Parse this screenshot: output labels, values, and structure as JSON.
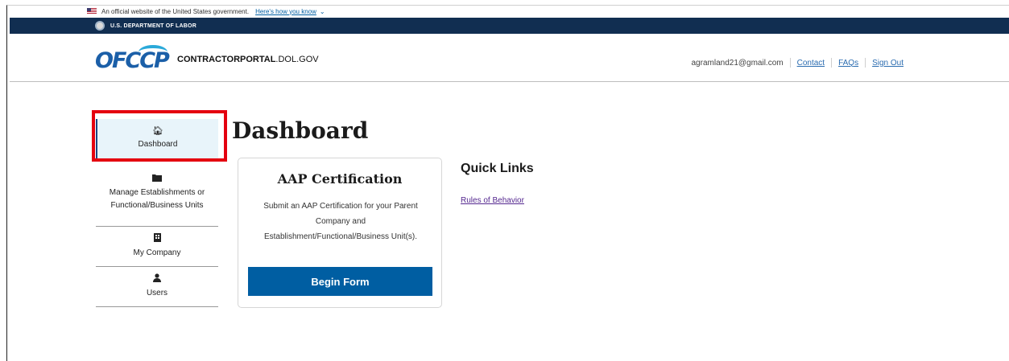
{
  "gov_banner": {
    "text": "An official website of the United States government.",
    "link": "Here's how you know",
    "chevron_icon": "chevron-down-icon"
  },
  "dept_bar": {
    "name": "U.S. DEPARTMENT OF LABOR",
    "seal_icon": "dol-seal-icon"
  },
  "header": {
    "logo_text": "OFCCP",
    "portal_bold": "CONTRACTORPORTAL",
    "portal_rest": ".DOL.GOV",
    "email": "agramland21@gmail.com",
    "links": [
      "Contact",
      "FAQs",
      "Sign Out"
    ]
  },
  "sidenav": {
    "items": [
      {
        "label": "Dashboard",
        "icon": "home-icon",
        "active": true
      },
      {
        "label": "Manage Establishments or Functional/Business Units",
        "icon": "folder-icon",
        "active": false
      },
      {
        "label": "My Company",
        "icon": "building-icon",
        "active": false
      },
      {
        "label": "Users",
        "icon": "user-icon",
        "active": false
      }
    ]
  },
  "main": {
    "title": "Dashboard",
    "card": {
      "title": "AAP Certification",
      "body": "Submit an AAP Certification for your Parent Company and Establishment/Functional/Business Unit(s).",
      "button": "Begin Form"
    },
    "quick_links": {
      "title": "Quick Links",
      "links": [
        "Rules of Behavior"
      ]
    }
  },
  "colors": {
    "dept_bar": "#112e51",
    "primary_button": "#005ea2",
    "active_nav_bg": "#e8f4fa",
    "highlight": "#e4000f",
    "visited_link": "#54278f"
  }
}
